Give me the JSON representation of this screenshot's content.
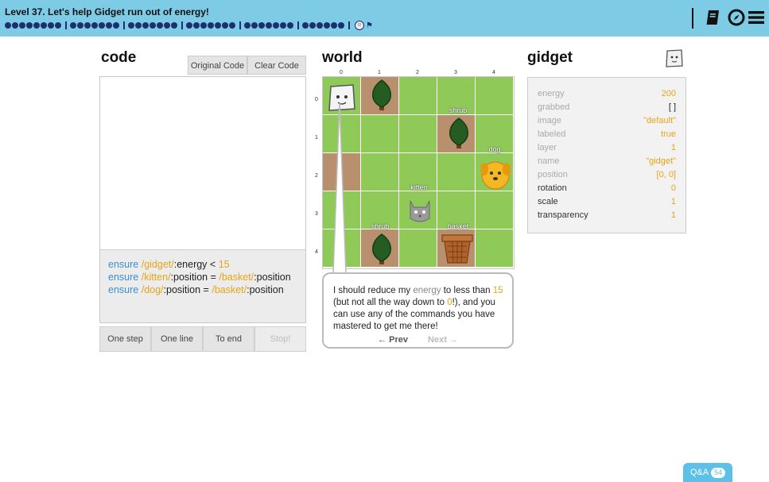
{
  "header": {
    "level_title": "Level 37. Let's help Gidget run out of energy!",
    "progress_groups": [
      8,
      7,
      7,
      7,
      7,
      6
    ],
    "icons": [
      "book-icon",
      "compass-icon",
      "menu-icon"
    ]
  },
  "code": {
    "title": "code",
    "original_label": "Original Code",
    "clear_label": "Clear Code",
    "goals": [
      {
        "kw": "ensure",
        "path": "/gidget/",
        "rest": ":energy < ",
        "num": "15"
      },
      {
        "kw": "ensure",
        "path": "/kitten/",
        "rest": ":position = ",
        "path2": "/basket/",
        "rest2": ":position"
      },
      {
        "kw": "ensure",
        "path": "/dog/",
        "rest": ":position = ",
        "path2": "/basket/",
        "rest2": ":position"
      }
    ],
    "controls": [
      "One step",
      "One line",
      "To end",
      "Stop!"
    ]
  },
  "world": {
    "title": "world",
    "col_labels": [
      "0",
      "1",
      "2",
      "3",
      "4"
    ],
    "row_labels": [
      "0",
      "1",
      "2",
      "3",
      "4"
    ],
    "object_labels": {
      "shrub_top": "shrub",
      "dog": "dog",
      "kitten": "kitten",
      "shrub_bottom": "shrub",
      "basket": "basket"
    },
    "bubble": {
      "t1": "I should reduce my ",
      "t2": "energy",
      "t3": " to less than ",
      "t4": "15",
      "t5": " (but not all the way down to ",
      "t6": "0",
      "t7": "!), and you can use any of the commands you have mastered to get me there!",
      "prev": "← Prev",
      "next": "Next →"
    }
  },
  "gidget": {
    "title": "gidget",
    "props": [
      {
        "k": "energy",
        "v": "200"
      },
      {
        "k": "grabbed",
        "v": "[ ]"
      },
      {
        "k": "image",
        "v": "\"default\""
      },
      {
        "k": "labeled",
        "v": "true"
      },
      {
        "k": "layer",
        "v": "1"
      },
      {
        "k": "name",
        "v": "\"gidget\""
      },
      {
        "k": "position",
        "v": "[0, 0]"
      },
      {
        "k": "rotation",
        "v": "0"
      },
      {
        "k": "scale",
        "v": "1"
      },
      {
        "k": "transparency",
        "v": "1"
      }
    ]
  },
  "qa": {
    "label": "Q&A",
    "count": "54"
  },
  "colors": {
    "topbar": "#7ecbe6",
    "grass": "#8fca59",
    "dirt": "#b9906e",
    "accent": "#e8a319",
    "keyword": "#3a8fd1"
  }
}
